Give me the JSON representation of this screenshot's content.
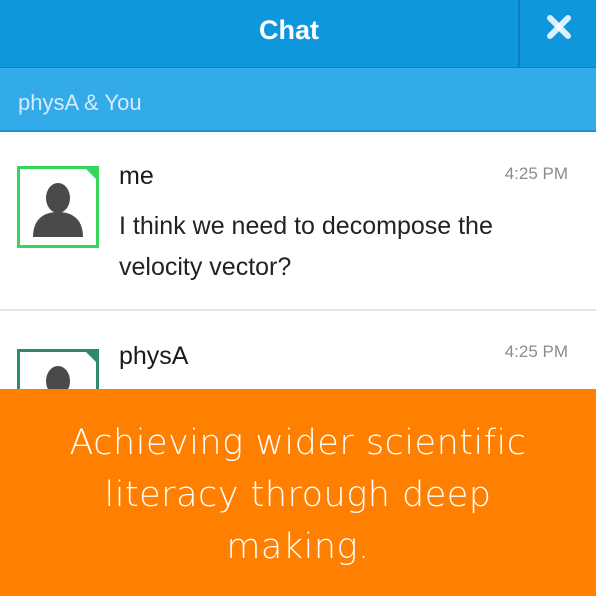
{
  "header": {
    "title": "Chat",
    "close_icon": "close-icon",
    "color": "#0f97dd"
  },
  "conversation": {
    "label": "physA & You",
    "color": "#33aaea"
  },
  "messages": [
    {
      "sender": "me",
      "time": "4:25 PM",
      "text": "I think we need to decompose the velocity vector?",
      "avatar_icon": "user-avatar-icon",
      "avatar_color": "#37d65a"
    },
    {
      "sender": "physA",
      "time": "4:25 PM",
      "text": "",
      "avatar_icon": "user-avatar-icon",
      "avatar_color": "#2a8a6a"
    }
  ],
  "banner": {
    "text": "Achieving wider scientific literacy through deep making.",
    "color": "#ff7f00"
  }
}
